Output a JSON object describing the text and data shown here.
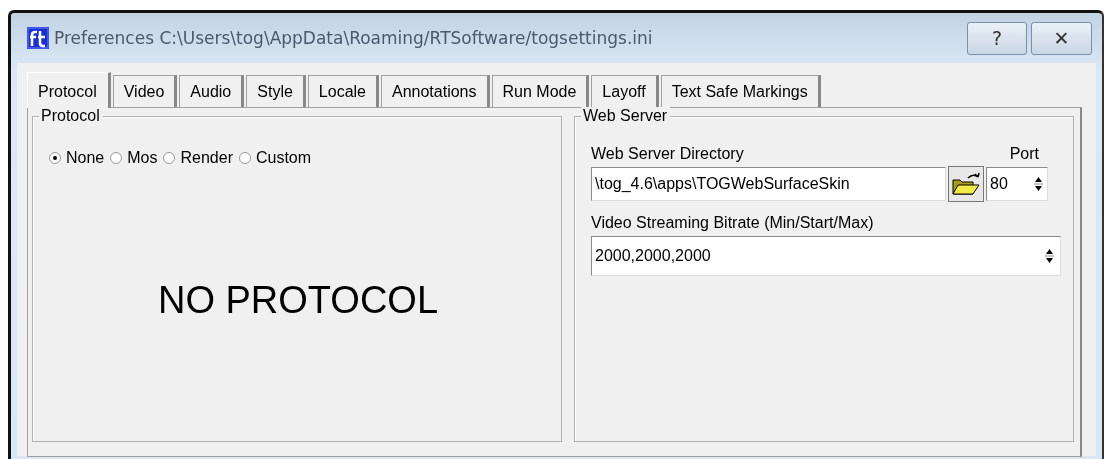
{
  "window": {
    "title": "Preferences C:\\Users\\tog\\AppData\\Roaming/RTSoftware/togsettings.ini",
    "buttons": [
      {
        "kind": "help",
        "label": "?"
      },
      {
        "kind": "close",
        "label": "✕"
      }
    ]
  },
  "tabs": [
    {
      "label": "Protocol",
      "selected": true
    },
    {
      "label": "Video",
      "selected": false
    },
    {
      "label": "Audio",
      "selected": false
    },
    {
      "label": "Style",
      "selected": false
    },
    {
      "label": "Locale",
      "selected": false
    },
    {
      "label": "Annotations",
      "selected": false
    },
    {
      "label": "Run Mode",
      "selected": false
    },
    {
      "label": "Layoff",
      "selected": false
    },
    {
      "label": "Text Safe Markings",
      "selected": false
    }
  ],
  "protocol_group": {
    "title": "Protocol",
    "options": [
      {
        "label": "None",
        "selected": true
      },
      {
        "label": "Mos",
        "selected": false
      },
      {
        "label": "Render",
        "selected": false
      },
      {
        "label": "Custom",
        "selected": false
      }
    ],
    "message": "NO PROTOCOL"
  },
  "web_server_group": {
    "title": "Web Server",
    "directory_label": "Web Server Directory",
    "directory_value": "\\tog_4.6\\apps\\TOGWebSurfaceSkin",
    "port_label": "Port",
    "port_value": "80",
    "bitrate_label": "Video Streaming Bitrate (Min/Start/Max)",
    "bitrate_value": "2000,2000,2000"
  }
}
